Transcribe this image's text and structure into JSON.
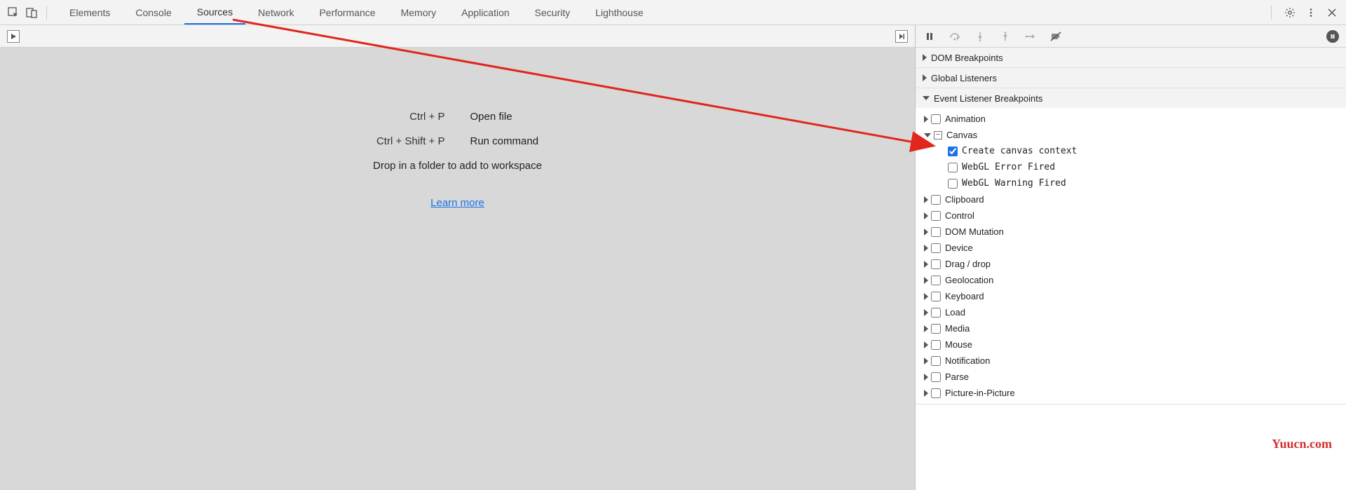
{
  "tabs": {
    "items": [
      "Elements",
      "Console",
      "Sources",
      "Network",
      "Performance",
      "Memory",
      "Application",
      "Security",
      "Lighthouse"
    ],
    "active": "Sources"
  },
  "left": {
    "openFileKey": "Ctrl + P",
    "openFileLabel": "Open file",
    "runCmdKey": "Ctrl + Shift + P",
    "runCmdLabel": "Run command",
    "dropLine": "Drop in a folder to add to workspace",
    "learnMore": "Learn more"
  },
  "sections": {
    "domBreakpoints": "DOM Breakpoints",
    "globalListeners": "Global Listeners",
    "eventListenerBreakpoints": "Event Listener Breakpoints"
  },
  "eventCategories": [
    {
      "label": "Animation",
      "expanded": false,
      "checked": false
    },
    {
      "label": "Canvas",
      "expanded": true,
      "partial": true,
      "children": [
        {
          "label": "Create canvas context",
          "checked": true
        },
        {
          "label": "WebGL Error Fired",
          "checked": false
        },
        {
          "label": "WebGL Warning Fired",
          "checked": false
        }
      ]
    },
    {
      "label": "Clipboard",
      "expanded": false,
      "checked": false
    },
    {
      "label": "Control",
      "expanded": false,
      "checked": false
    },
    {
      "label": "DOM Mutation",
      "expanded": false,
      "checked": false
    },
    {
      "label": "Device",
      "expanded": false,
      "checked": false
    },
    {
      "label": "Drag / drop",
      "expanded": false,
      "checked": false
    },
    {
      "label": "Geolocation",
      "expanded": false,
      "checked": false
    },
    {
      "label": "Keyboard",
      "expanded": false,
      "checked": false
    },
    {
      "label": "Load",
      "expanded": false,
      "checked": false
    },
    {
      "label": "Media",
      "expanded": false,
      "checked": false
    },
    {
      "label": "Mouse",
      "expanded": false,
      "checked": false
    },
    {
      "label": "Notification",
      "expanded": false,
      "checked": false
    },
    {
      "label": "Parse",
      "expanded": false,
      "checked": false
    },
    {
      "label": "Picture-in-Picture",
      "expanded": false,
      "checked": false
    }
  ],
  "watermark": "Yuucn.com"
}
